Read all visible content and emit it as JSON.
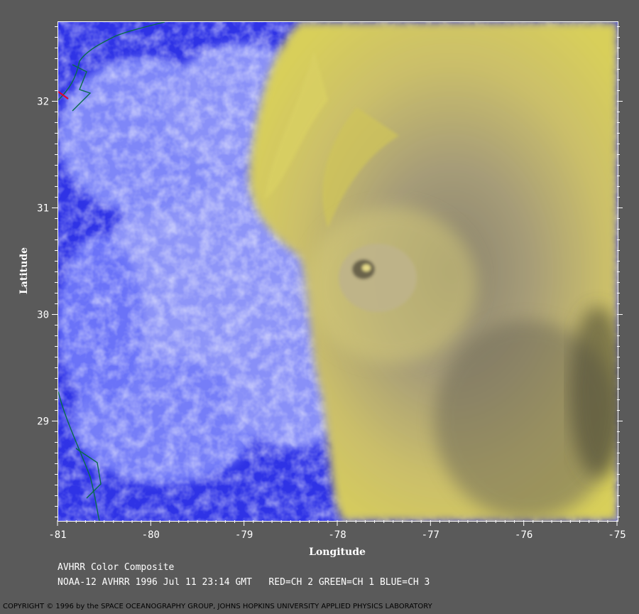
{
  "figure": {
    "caption_title": "AVHRR Color Composite",
    "caption_detail": "NOAA-12 AVHRR 1996 Jul 11 23:14 GMT   RED=CH 2 GREEN=CH 1 BLUE=CH 3",
    "copyright": "COPYRIGHT © 1996 by the SPACE OCEANOGRAPHY GROUP, JOHNS HOPKINS UNIVERSITY APPLIED PHYSICS LABORATORY"
  },
  "axes": {
    "xlabel": "Longitude",
    "ylabel": "Latitude",
    "x_range": [
      -81,
      -75
    ],
    "y_range": [
      28.07,
      32.75
    ],
    "x_ticks": [
      -81,
      -80,
      -79,
      -78,
      -77,
      -76,
      -75
    ],
    "x_tick_labels": [
      "-81",
      "-80",
      "-79",
      "-78",
      "-77",
      "-76",
      "-75"
    ],
    "y_ticks": [
      29,
      30,
      31,
      32
    ],
    "y_tick_labels": [
      "29",
      "30",
      "31",
      "32"
    ]
  },
  "colors": {
    "ocean_clear": "#2f33e6",
    "low_cloud": "#b9c2ff",
    "hurricane_cloud": "#d6cc6a",
    "hurricane_dark": "#7d7660",
    "coastline": "#0a6b4a",
    "background": "#5a5a5a"
  },
  "features": {
    "hurricane_eye": {
      "lon": -77.7,
      "lat": 30.45
    },
    "coastlines": [
      "Georgia / South Carolina coast",
      "Florida coast"
    ]
  }
}
